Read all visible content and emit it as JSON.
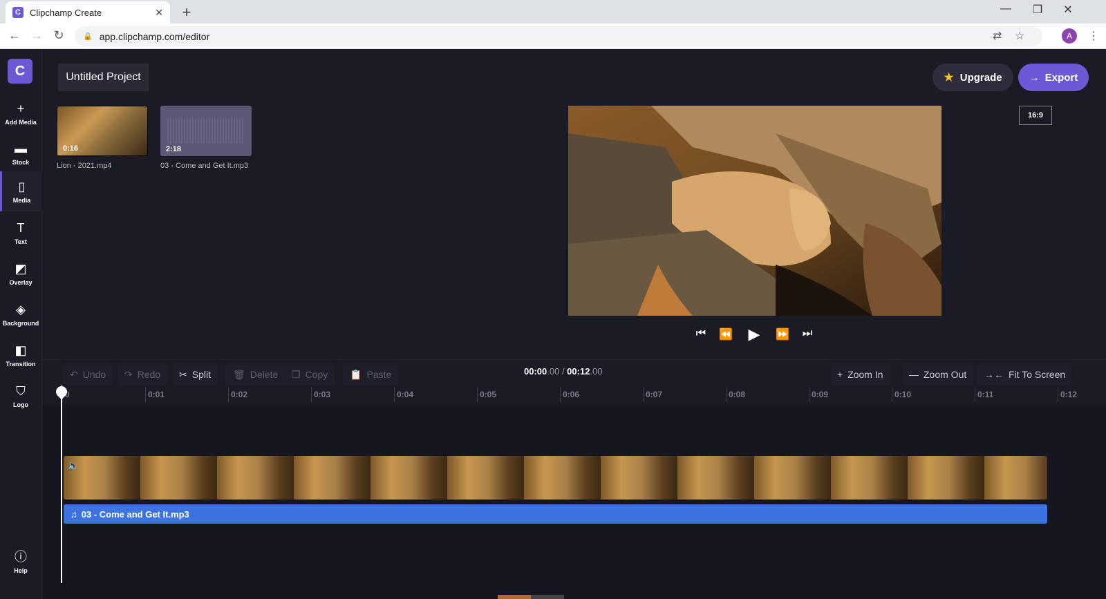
{
  "browser": {
    "tab_title": "Clipchamp Create",
    "tab_favicon": "C",
    "url": "app.clipchamp.com/editor",
    "avatar": "A"
  },
  "app": {
    "logo": "C",
    "project_title": "Untitled Project",
    "upgrade_label": "Upgrade",
    "export_label": "Export",
    "aspect_ratio": "16:9",
    "accent_color": "#6b59d6",
    "audio_track_color": "#3d73e0"
  },
  "sidebar": {
    "items": [
      {
        "label": "Add Media",
        "icon": "plus-icon"
      },
      {
        "label": "Stock",
        "icon": "stock-icon"
      },
      {
        "label": "Media",
        "icon": "file-icon"
      },
      {
        "label": "Text",
        "icon": "text-icon"
      },
      {
        "label": "Overlay",
        "icon": "overlay-icon"
      },
      {
        "label": "Background",
        "icon": "layers-icon"
      },
      {
        "label": "Transition",
        "icon": "transition-icon"
      },
      {
        "label": "Logo",
        "icon": "shield-icon"
      }
    ],
    "help_label": "Help"
  },
  "media": [
    {
      "name": "Lion - 2021.mp4",
      "duration": "0:16",
      "kind": "video"
    },
    {
      "name": "03 - Come and Get It.mp3",
      "duration": "2:18",
      "kind": "audio"
    }
  ],
  "toolbar": {
    "undo": "Undo",
    "redo": "Redo",
    "split": "Split",
    "delete": "Delete",
    "copy": "Copy",
    "paste": "Paste",
    "zoom_in": "Zoom In",
    "zoom_out": "Zoom Out",
    "fit_to_screen": "Fit To Screen"
  },
  "timecode": {
    "current_main": "00:00",
    "current_frac": ".00",
    "separator": " / ",
    "total_main": "00:12",
    "total_frac": ".00"
  },
  "ruler": {
    "ticks": [
      "0",
      "0:01",
      "0:02",
      "0:03",
      "0:04",
      "0:05",
      "0:06",
      "0:07",
      "0:08",
      "0:09",
      "0:10",
      "0:11",
      "0:12"
    ]
  },
  "timeline": {
    "audio_clip_label": "03 - Come and Get It.mp3"
  }
}
